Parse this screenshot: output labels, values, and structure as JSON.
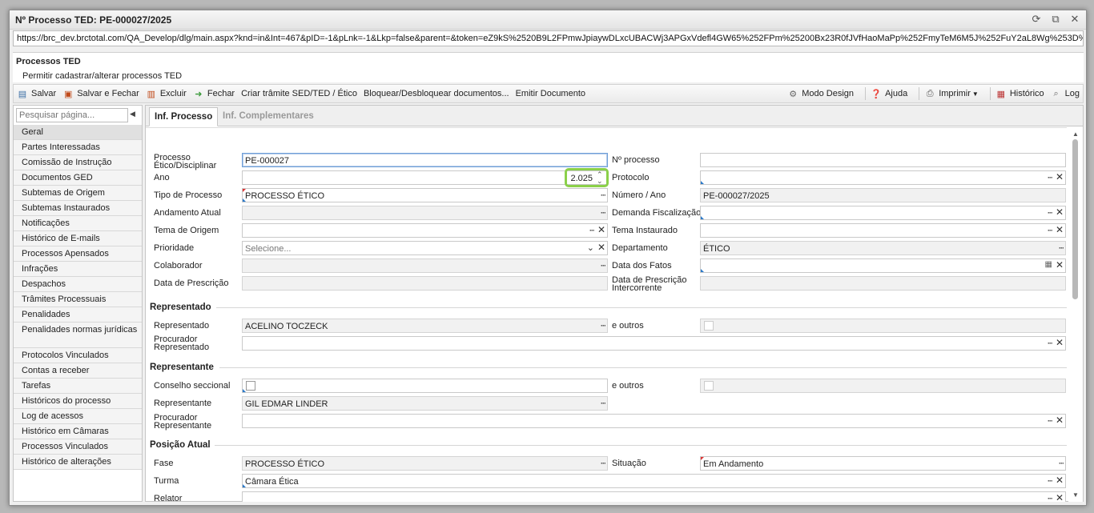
{
  "window": {
    "title": "Nº Processo TED: PE-000027/2025",
    "url": "https://brc_dev.brctotal.com/QA_Develop/dlg/main.aspx?knd=in&Int=467&pID=-1&pLnk=-1&Lkp=false&parent=&token=eZ9kS%2520B9L2FPmwJpiaywDLxcUBACWj3APGxVdefl4GW65%252FPm%25200Bx23R0fJVfHaoMaPp%252FmyTeM6M5J%252FuY2aL8Wg%253D%25"
  },
  "header": {
    "title": "Processos TED",
    "subtitle": "Permitir cadastrar/alterar processos TED"
  },
  "toolbar": {
    "save": "Salvar",
    "save_close": "Salvar e Fechar",
    "delete": "Excluir",
    "close": "Fechar",
    "create_procedure": "Criar trâmite SED/TED / Ético",
    "lock_docs": "Bloquear/Desbloquear documentos...",
    "emit_doc": "Emitir Documento",
    "design_mode": "Modo Design",
    "help": "Ajuda",
    "print": "Imprimir",
    "history": "Histórico",
    "log": "Log"
  },
  "sidebar": {
    "search_placeholder": "Pesquisar página...",
    "items": [
      "Geral",
      "Partes Interessadas",
      "Comissão de Instrução",
      "Documentos GED",
      "Subtemas de Origem",
      "Subtemas Instaurados",
      "Notificações",
      "Histórico de E-mails",
      "Processos Apensados",
      "Infrações",
      "Despachos",
      "Trâmites Processuais",
      "Penalidades",
      "Penalidades normas jurídicas",
      "Protocolos Vinculados",
      "Contas a receber",
      "Tarefas",
      "Históricos do processo",
      "Log de acessos",
      "Histórico em Câmaras",
      "Processos Vinculados",
      "Histórico de alterações"
    ]
  },
  "tabs": {
    "tab1": "Inf. Processo",
    "tab2": "Inf. Complementares"
  },
  "form": {
    "processo_label": "Processo Ético/Disciplinar",
    "processo_value": "PE-000027",
    "nprocesso_label": "Nº processo",
    "nprocesso_value": "",
    "ano_label": "Ano",
    "ano_value": "2.025",
    "protocolo_label": "Protocolo",
    "tipo_label": "Tipo de Processo",
    "tipo_value": "PROCESSO ÉTICO",
    "numano_label": "Número / Ano",
    "numano_value": "PE-000027/2025",
    "andamento_label": "Andamento Atual",
    "demanda_label": "Demanda Fiscalização",
    "tema_origem_label": "Tema de Origem",
    "tema_inst_label": "Tema Instaurado",
    "prioridade_label": "Prioridade",
    "prioridade_value": "Selecione...",
    "departamento_label": "Departamento",
    "departamento_value": "ÉTICO",
    "colaborador_label": "Colaborador",
    "data_fatos_label": "Data dos Fatos",
    "data_presc_label": "Data de Prescrição",
    "data_presc_inter_label": "Data de Prescrição Intercorrente",
    "sec_representado": "Representado",
    "representado_label": "Representado",
    "representado_value": "ACELINO TOCZECK",
    "e_outros_label": "e outros",
    "proc_representado_label": "Procurador Representado",
    "sec_representante": "Representante",
    "conselho_label": "Conselho seccional",
    "representante_label": "Representante",
    "representante_value": "GIL EDMAR LINDER",
    "proc_representante_label": "Procurador Representante",
    "sec_posicao": "Posição Atual",
    "fase_label": "Fase",
    "fase_value": "PROCESSO ÉTICO",
    "situacao_label": "Situação",
    "situacao_value": "Em Andamento",
    "turma_label": "Turma",
    "turma_value": "Câmara Ética",
    "relator_label": "Relator"
  }
}
